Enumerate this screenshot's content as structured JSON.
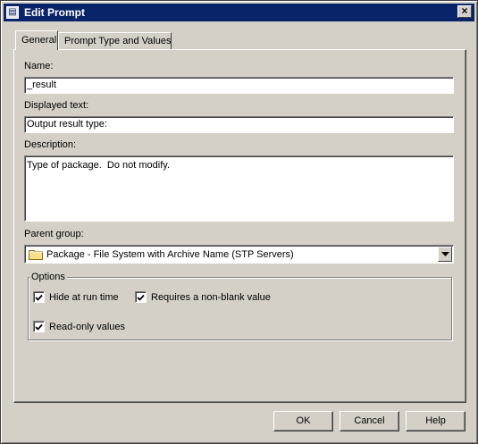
{
  "window": {
    "title": "Edit Prompt"
  },
  "tabs": [
    {
      "label": "General"
    },
    {
      "label": "Prompt Type and Values"
    }
  ],
  "form": {
    "name_label": "Name:",
    "name_value": "_result",
    "displayed_text_label": "Displayed text:",
    "displayed_text_value": "Output result type:",
    "description_label": "Description:",
    "description_value": "Type of package.  Do not modify.",
    "parent_group_label": "Parent group:",
    "parent_group_value": "Package - File System with Archive Name (STP Servers)"
  },
  "options": {
    "legend": "Options",
    "items": [
      {
        "label": "Hide at run time",
        "checked": true
      },
      {
        "label": "Requires a non-blank value",
        "checked": true
      },
      {
        "label": "Read-only values",
        "checked": true
      }
    ]
  },
  "buttons": {
    "ok": "OK",
    "cancel": "Cancel",
    "help": "Help"
  },
  "colors": {
    "titlebar": "#0a246a",
    "face": "#d4d0c8"
  }
}
